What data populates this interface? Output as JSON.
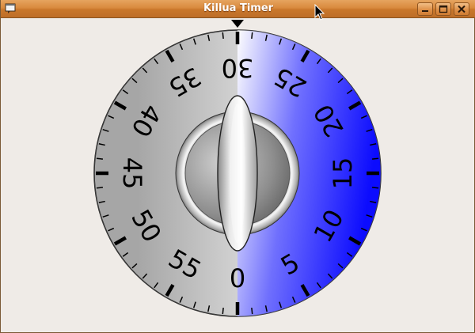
{
  "window": {
    "title": "Killua Timer"
  },
  "titlebar_buttons": {
    "minimize": "minimize-icon",
    "maximize": "maximize-icon",
    "close": "close-icon"
  },
  "dial": {
    "labels": [
      "0",
      "5",
      "10",
      "15",
      "20",
      "25",
      "30",
      "35",
      "40",
      "45",
      "50",
      "55"
    ],
    "minutes_set": 30,
    "pointer_icon": "pointer-triangle-icon",
    "accent_color": "#0000ff"
  }
}
